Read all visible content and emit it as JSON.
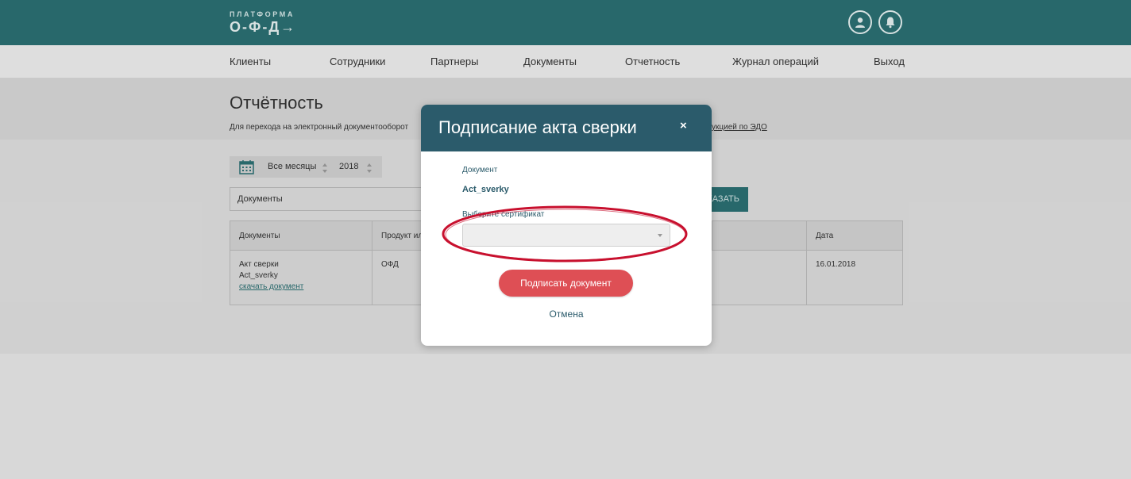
{
  "logo": {
    "small": "ПЛАТФОРМА",
    "big": "О-Ф-Д→"
  },
  "top_icons": [
    "user-icon",
    "bell-icon"
  ],
  "nav": {
    "items": [
      "Клиенты",
      "Сотрудники",
      "Партнеры",
      "Документы",
      "Отчетность",
      "Журнал операций",
      "Выход"
    ]
  },
  "page": {
    "title": "Отчётность",
    "subtitle": "Для перехода на электронный документооборот",
    "subtitle_link": "укцией по ЭДО"
  },
  "filters": {
    "month": "Все месяцы",
    "year": "2018",
    "document_type": "Документы",
    "show_button": "КАЗАТЬ"
  },
  "table": {
    "headers": [
      "Документы",
      "Продукт ил",
      "",
      "Дата"
    ],
    "rows": [
      {
        "doc_title": "Акт сверки",
        "doc_file": "Act_sverky",
        "download": "скачать документ",
        "product": "ОФД",
        "date": "16.01.2018"
      }
    ]
  },
  "modal": {
    "title": "Подписание акта сверки",
    "close": "×",
    "doc_label": "Документ",
    "doc_name": "Act_sverky",
    "cert_label": "Выберите сертификат",
    "cert_value": "",
    "sign_button": "Подписать документ",
    "cancel": "Отмена"
  },
  "colors": {
    "brand_teal": "#2b6f72",
    "modal_header": "#2b5b6b",
    "sign_button": "#de4f55",
    "annotation": "#c8102e"
  }
}
